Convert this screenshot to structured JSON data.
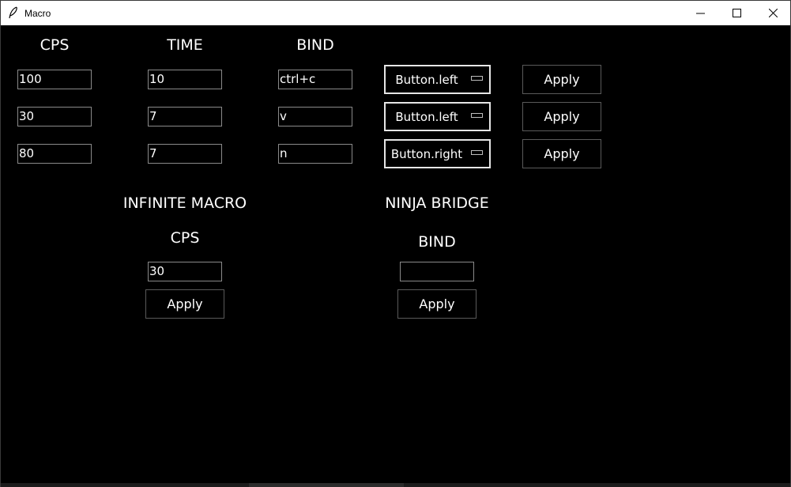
{
  "window": {
    "title": "Macro"
  },
  "headers": {
    "cps": "CPS",
    "time": "TIME",
    "bind": "BIND"
  },
  "rows": [
    {
      "cps": "100",
      "time": "10",
      "bind": "ctrl+c",
      "button": "Button.left",
      "apply": "Apply"
    },
    {
      "cps": "30",
      "time": "7",
      "bind": "v",
      "button": "Button.left",
      "apply": "Apply"
    },
    {
      "cps": "80",
      "time": "7",
      "bind": "n",
      "button": "Button.right",
      "apply": "Apply"
    }
  ],
  "infinite_macro": {
    "title": "INFINITE MACRO",
    "cps_label": "CPS",
    "cps_value": "30",
    "apply": "Apply"
  },
  "ninja_bridge": {
    "title": "NINJA BRIDGE",
    "bind_label": "BIND",
    "bind_value": "",
    "apply": "Apply"
  },
  "icons": {
    "app": "feather-icon",
    "minimize": "minimize-icon",
    "maximize": "maximize-icon",
    "close": "close-icon"
  },
  "colors": {
    "background": "#000000",
    "text": "#ffffff",
    "titlebar": "#ffffff"
  }
}
